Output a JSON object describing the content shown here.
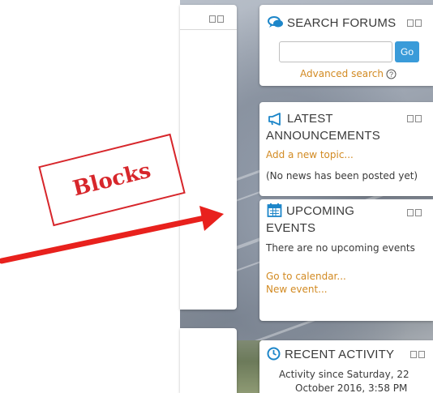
{
  "annotation": {
    "label": "Blocks",
    "color": "#d7262b"
  },
  "blocks": {
    "search_forums": {
      "title": "SEARCH FORUMS",
      "icon": "chat-bubbles-icon",
      "search_placeholder": "",
      "go_label": "Go",
      "advanced_link": "Advanced search",
      "help_icon": "help-circle-icon"
    },
    "latest_announcements": {
      "title_line1": "LATEST",
      "title_line2": "ANNOUNCEMENTS",
      "icon": "megaphone-icon",
      "add_link": "Add a new topic...",
      "empty_text": "(No news has been posted yet)"
    },
    "upcoming_events": {
      "title_line1": "UPCOMING",
      "title_line2": "EVENTS",
      "icon": "calendar-icon",
      "empty_text": "There are no upcoming events",
      "calendar_link": "Go to calendar...",
      "new_event_link": "New event..."
    },
    "recent_activity": {
      "title": "RECENT ACTIVITY",
      "icon": "clock-icon",
      "text_line1": "Activity since Saturday, 22",
      "text_line2": "October 2016, 3:58 PM"
    }
  },
  "colors": {
    "link": "#d28a22",
    "button": "#3a9bd9",
    "icon": "#1d86c9"
  }
}
